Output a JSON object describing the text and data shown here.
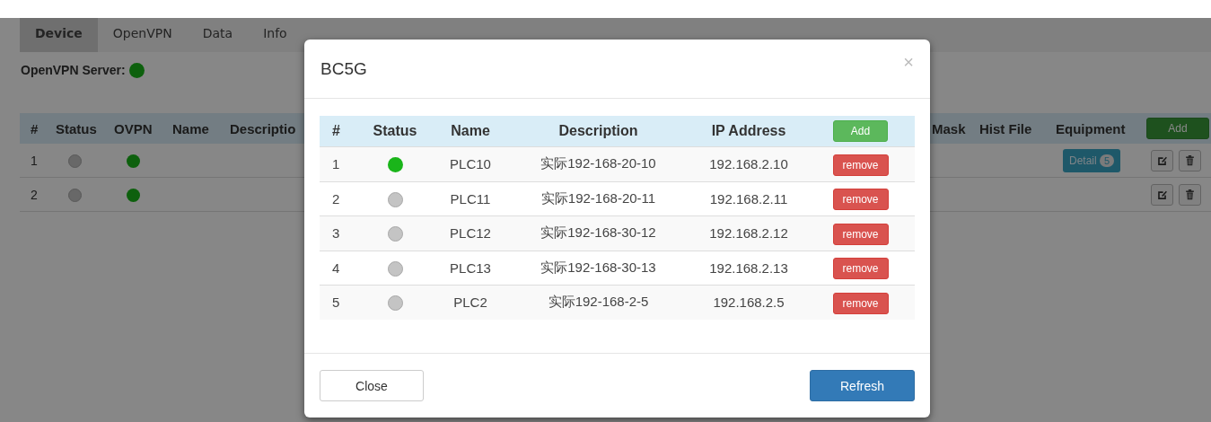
{
  "tabs": [
    {
      "label": "Device",
      "selected": true
    },
    {
      "label": "OpenVPN",
      "selected": false
    },
    {
      "label": "Data",
      "selected": false
    },
    {
      "label": "Info",
      "selected": false
    }
  ],
  "server": {
    "label": "OpenVPN Server:",
    "online": true
  },
  "device_table": {
    "columns": [
      "#",
      "Status",
      "OVPN",
      "Name",
      "Descriptio",
      "Mask",
      "Hist File",
      "Equipment"
    ],
    "add_button": "Add",
    "rows": [
      {
        "index": "1",
        "online": false,
        "ovpn": true,
        "detail": {
          "label": "Detail",
          "count": "5"
        }
      },
      {
        "index": "2",
        "online": false,
        "ovpn": true
      }
    ]
  },
  "modal": {
    "title": "BC5G",
    "close_icon": "×",
    "columns": [
      "#",
      "Status",
      "Name",
      "Description",
      "IP Address"
    ],
    "add_button": "Add",
    "rows": [
      {
        "index": "1",
        "online": true,
        "name": "PLC10",
        "description": "实际192-168-20-10",
        "ip": "192.168.2.10",
        "action": "remove"
      },
      {
        "index": "2",
        "online": false,
        "name": "PLC11",
        "description": "实际192-168-20-11",
        "ip": "192.168.2.11",
        "action": "remove"
      },
      {
        "index": "3",
        "online": false,
        "name": "PLC12",
        "description": "实际192-168-30-12",
        "ip": "192.168.2.12",
        "action": "remove"
      },
      {
        "index": "4",
        "online": false,
        "name": "PLC13",
        "description": "实际192-168-30-13",
        "ip": "192.168.2.13",
        "action": "remove"
      },
      {
        "index": "5",
        "online": false,
        "name": "PLC2",
        "description": "实际192-168-2-5",
        "ip": "192.168.2.5",
        "action": "remove"
      }
    ],
    "buttons": {
      "close": "Close",
      "refresh": "Refresh"
    }
  }
}
